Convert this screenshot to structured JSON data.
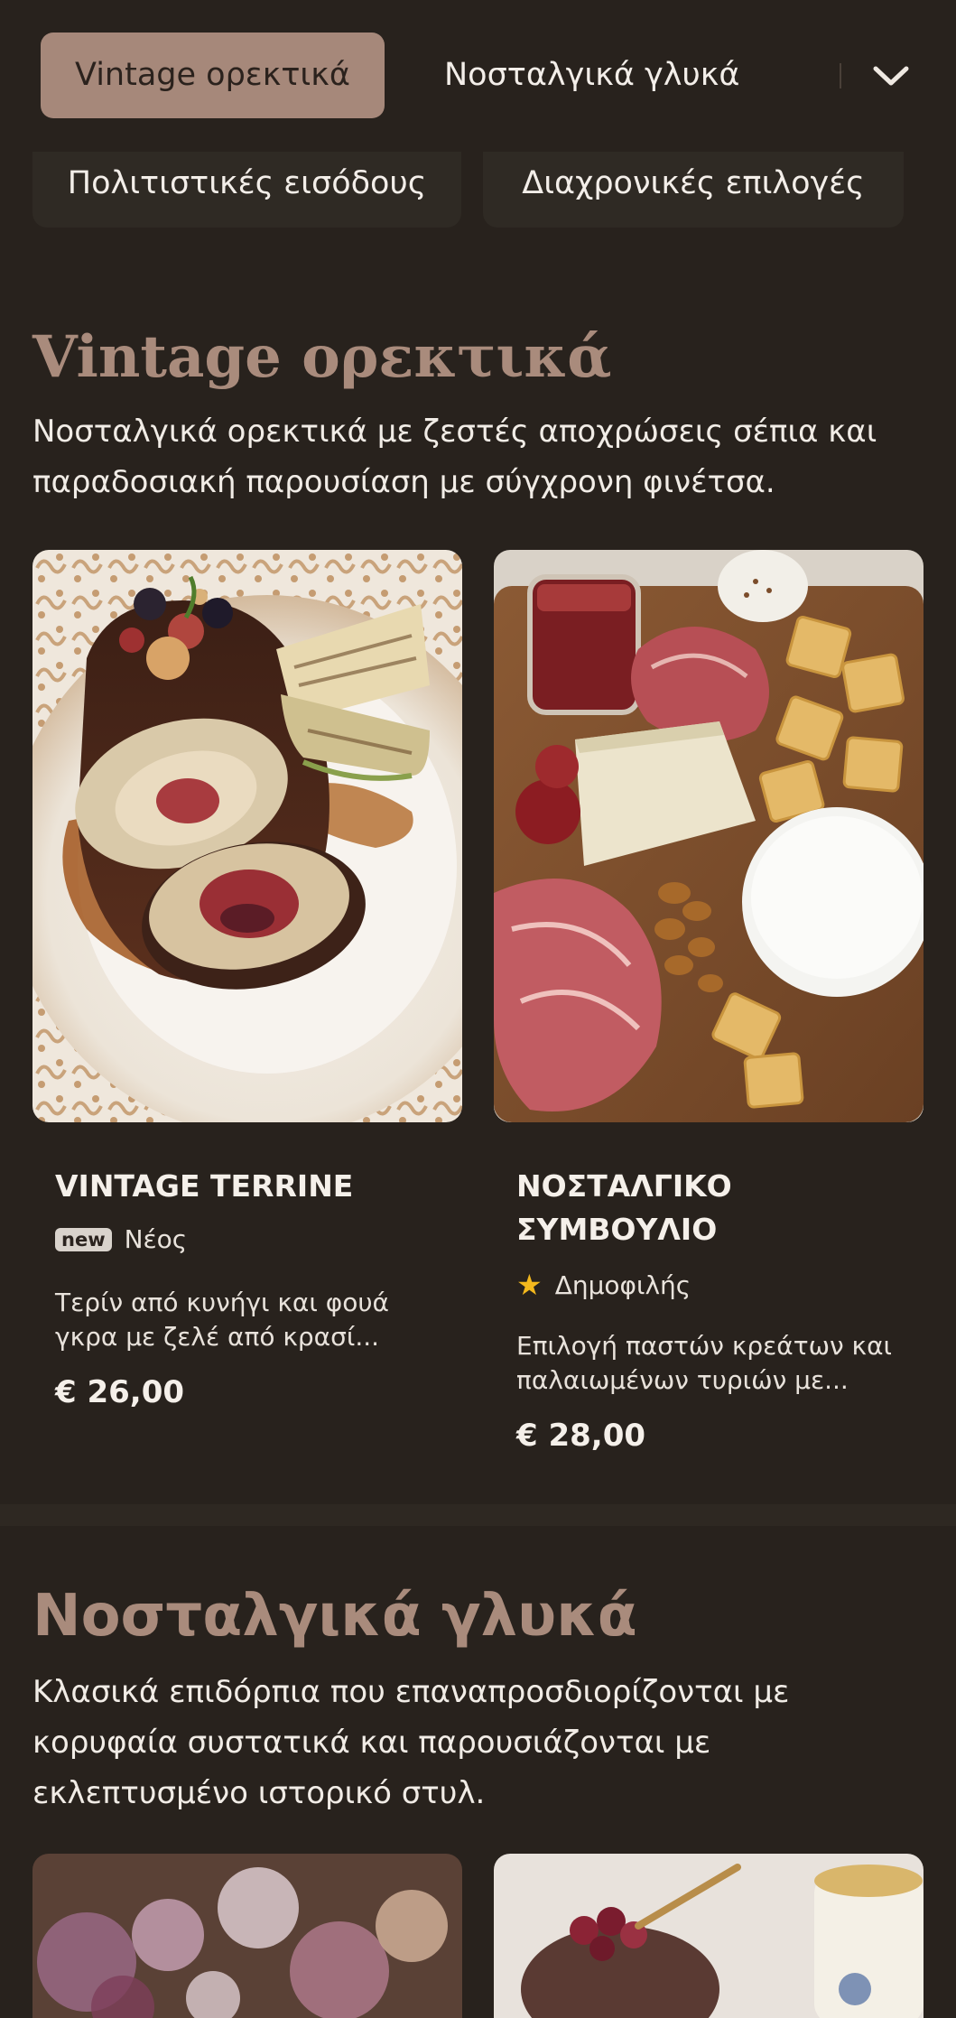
{
  "nav": {
    "active_category": "Vintage ορεκτικά",
    "next_category": "Νοσταλγικά γλυκά",
    "row2": [
      "Πολιτιστικές εισόδους",
      "Διαχρονικές επιλογές"
    ]
  },
  "section1": {
    "title": "Vintage ορεκτικά",
    "description": "Νοσταλγικά ορεκτικά με ζεστές αποχρώσεις σέπια και παραδοσιακή παρουσίαση με σύγχρονη φινέτσα.",
    "items": [
      {
        "name": "VINTAGE TERRINE",
        "badge": "new",
        "badge_label": "Νέος",
        "description": "Τερίν από κυνήγι και φουά γκρα με ζελέ από κρασί...",
        "price": "€ 26,00"
      },
      {
        "name": "ΝΟΣΤΑΛΓΙΚΟ ΣΥΜΒΟΥΛΙΟ",
        "badge": "★",
        "badge_label": "Δημοφιλής",
        "description": "Επιλογή παστών κρεάτων και παλαιωμένων τυριών με...",
        "price": "€ 28,00"
      }
    ]
  },
  "section2": {
    "title": "Νοσταλγικά γλυκά",
    "description": "Κλασικά επιδόρπια που επαναπροσδιορίζονται με κορυφαία συστατικά και παρουσιάζονται με εκλεπτυσμένο ιστορικό στυλ."
  },
  "colors": {
    "background": "#28221d",
    "accent": "#a6887a",
    "star": "#f3b81d"
  }
}
